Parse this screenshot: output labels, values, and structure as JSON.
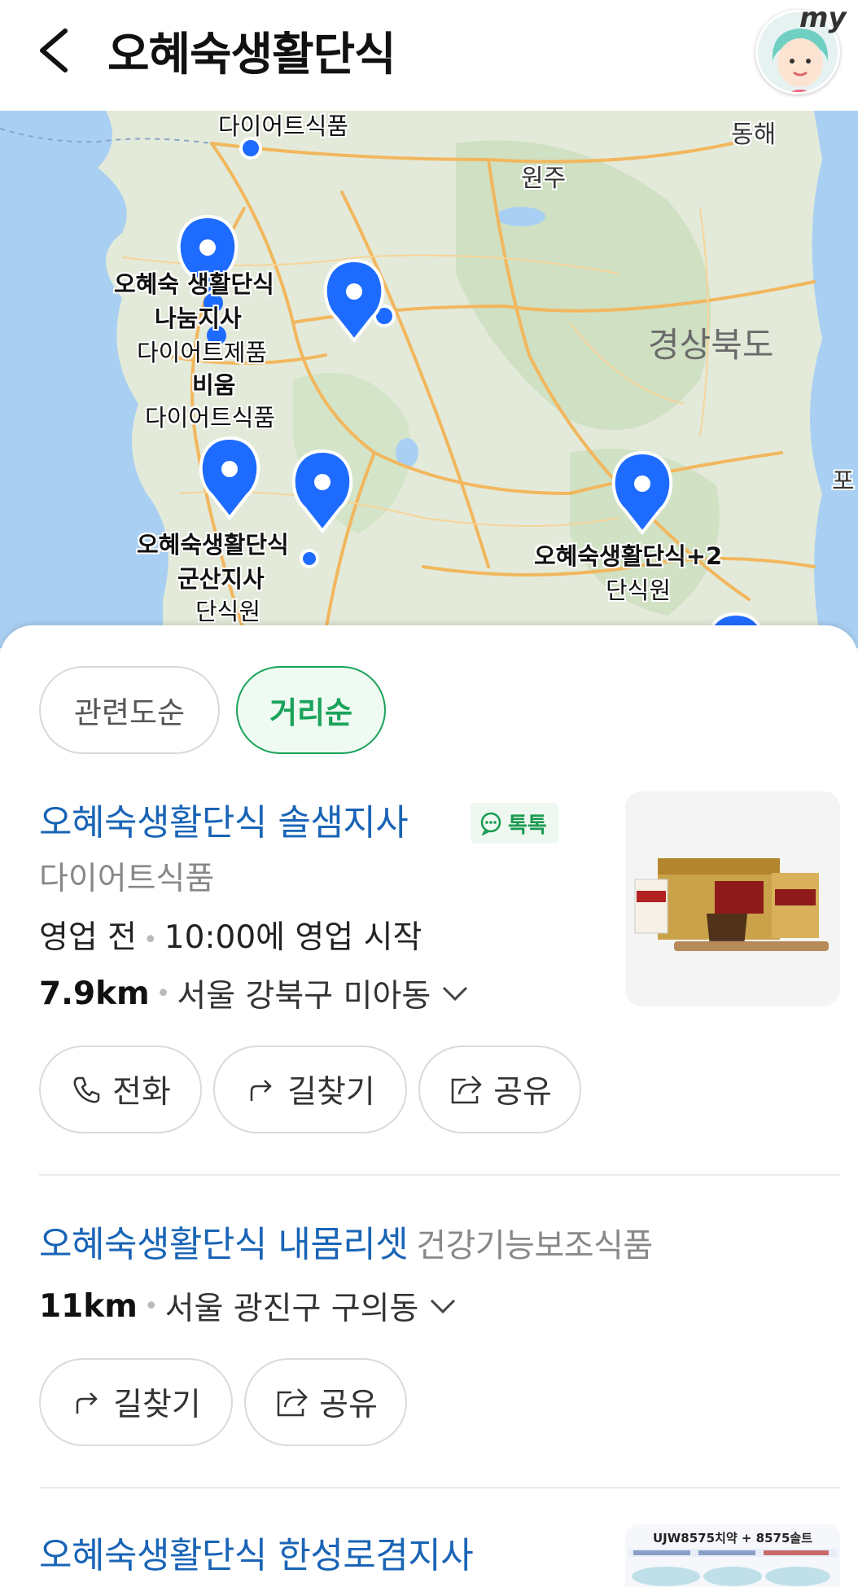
{
  "header": {
    "title": "오혜숙생활단식",
    "my_label": "my"
  },
  "map": {
    "labels": {
      "top_category": "다이어트식품",
      "donghae": "동해",
      "wonju": "원주",
      "gyeongbuk": "경상북도",
      "po": "포",
      "pin1_title": "오혜숙 생활단식",
      "pin1_branch": "나눔지사",
      "pin1_cat": "다이어트제품",
      "pin2_title": "비움",
      "pin2_cat": "다이어트식품",
      "pin3_title": "오혜숙생활단식",
      "pin3_branch": "군산지사",
      "pin3_cat": "단식원",
      "pin4_title": "오혜숙생활단식+2",
      "pin4_cat": "단식원"
    },
    "pin_color": "#1e6bff"
  },
  "sort": {
    "relevance": "관련도순",
    "distance": "거리순"
  },
  "results": [
    {
      "name": "오혜숙생활단식 솔샘지사",
      "talk": "톡톡",
      "category": "다이어트식품",
      "status": "영업 전",
      "hours": "10:00에 영업 시작",
      "distance": "7.9km",
      "address": "서울 강북구 미아동",
      "actions": {
        "call": "전화",
        "route": "길찾기",
        "share": "공유"
      }
    },
    {
      "name": "오혜숙생활단식 내몸리셋",
      "category": "건강기능보조식품",
      "distance": "11km",
      "address": "서울 광진구 구의동",
      "actions": {
        "route": "길찾기",
        "share": "공유"
      }
    },
    {
      "name": "오혜숙생활단식 한성로겸지사",
      "thumb_text": "UJW8575치약 + 8575솔트"
    }
  ]
}
